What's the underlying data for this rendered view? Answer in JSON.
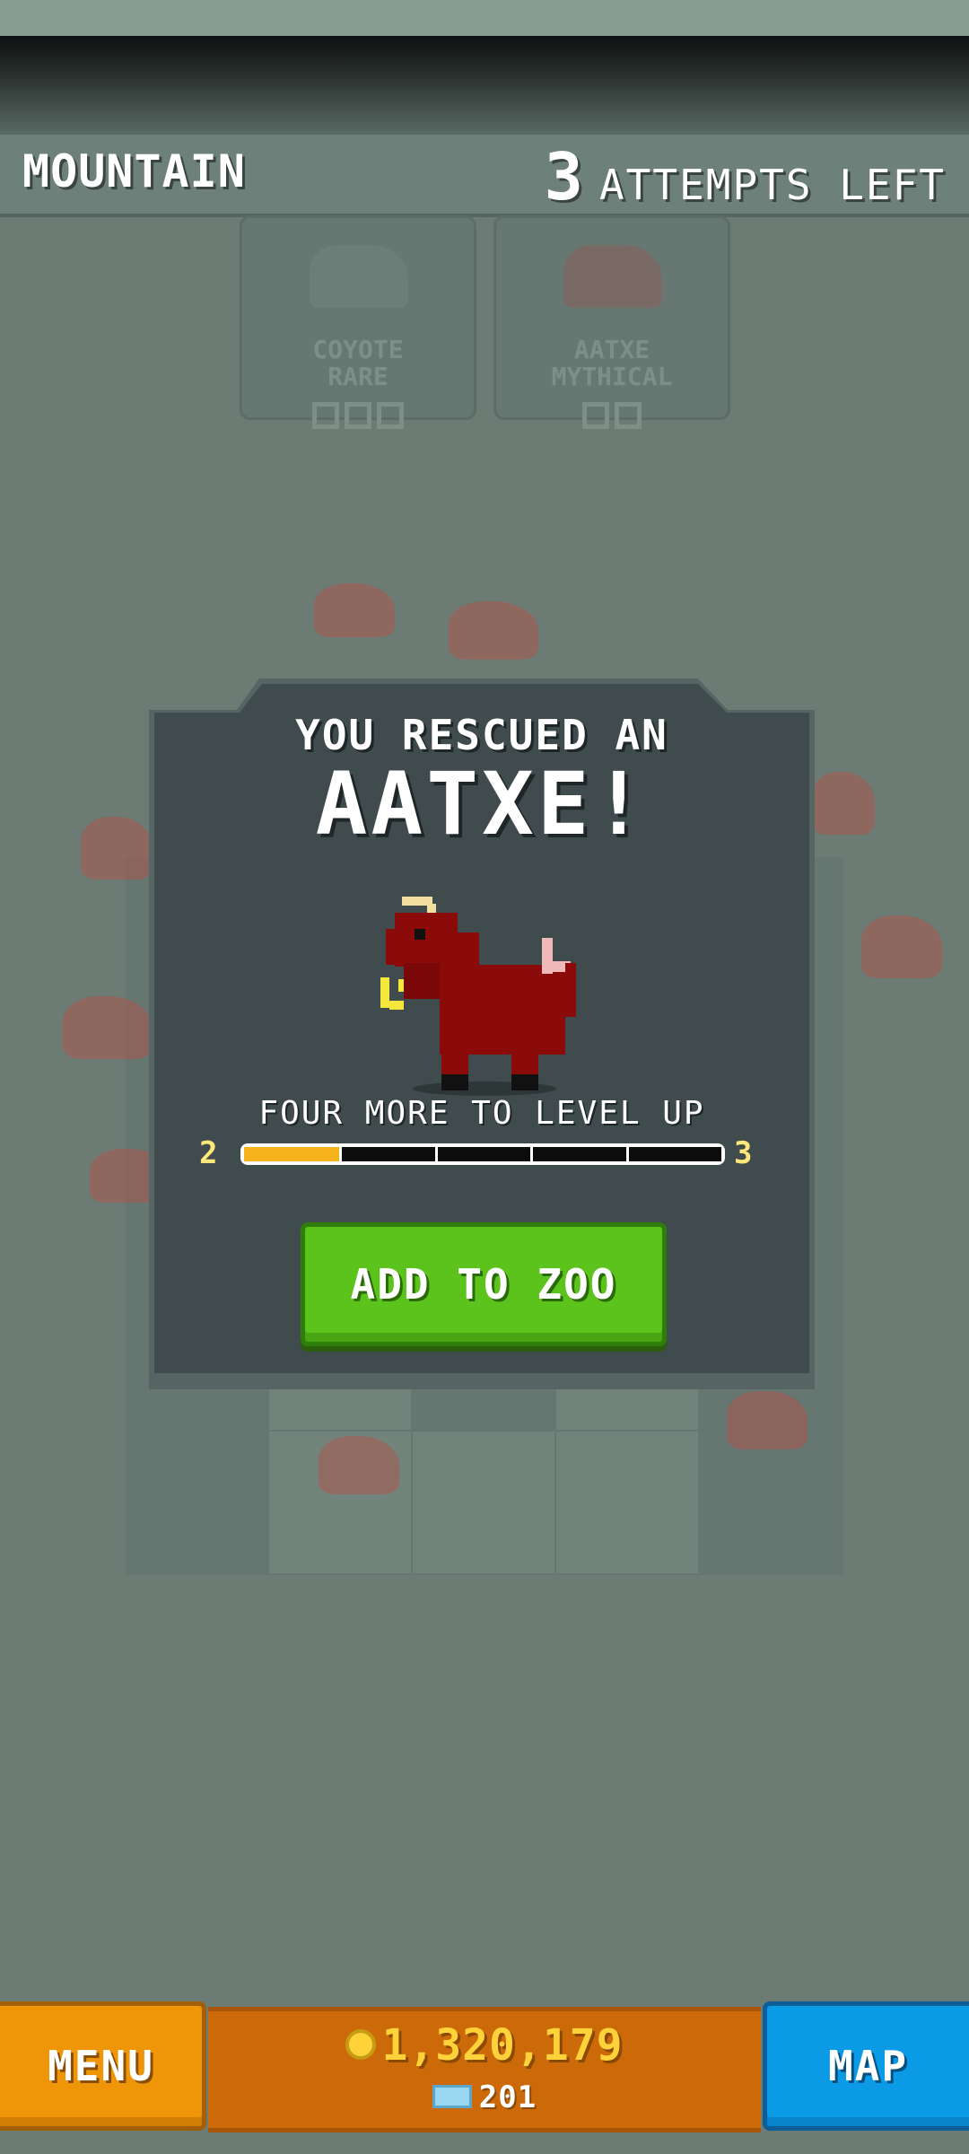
{
  "header": {
    "biome": "MOUNTAIN",
    "attempts_count": "3",
    "attempts_label": "ATTEMPTS LEFT"
  },
  "background_cards": [
    {
      "name": "COYOTE",
      "rarity": "RARE",
      "boxes": 3
    },
    {
      "name": "AATXE",
      "rarity": "MYTHICAL",
      "boxes": 2
    }
  ],
  "modal": {
    "heading": "YOU RESCUED AN",
    "animal_name": "AATXE!",
    "level_text": "FOUR MORE TO LEVEL UP",
    "level_from": "2",
    "level_to": "3",
    "progress": 0.2,
    "segments": 5,
    "add_button": "ADD TO ZOO"
  },
  "bottom_bar": {
    "menu_label": "MENU",
    "coins": "1,320,179",
    "gems": "201",
    "map_label": "MAP"
  },
  "colors": {
    "accent_green": "#5cc21c",
    "progress_fill": "#f5b21b",
    "menu_orange": "#ef9508",
    "map_blue": "#0a9ae6",
    "animal_red": "#8b0a0a"
  }
}
